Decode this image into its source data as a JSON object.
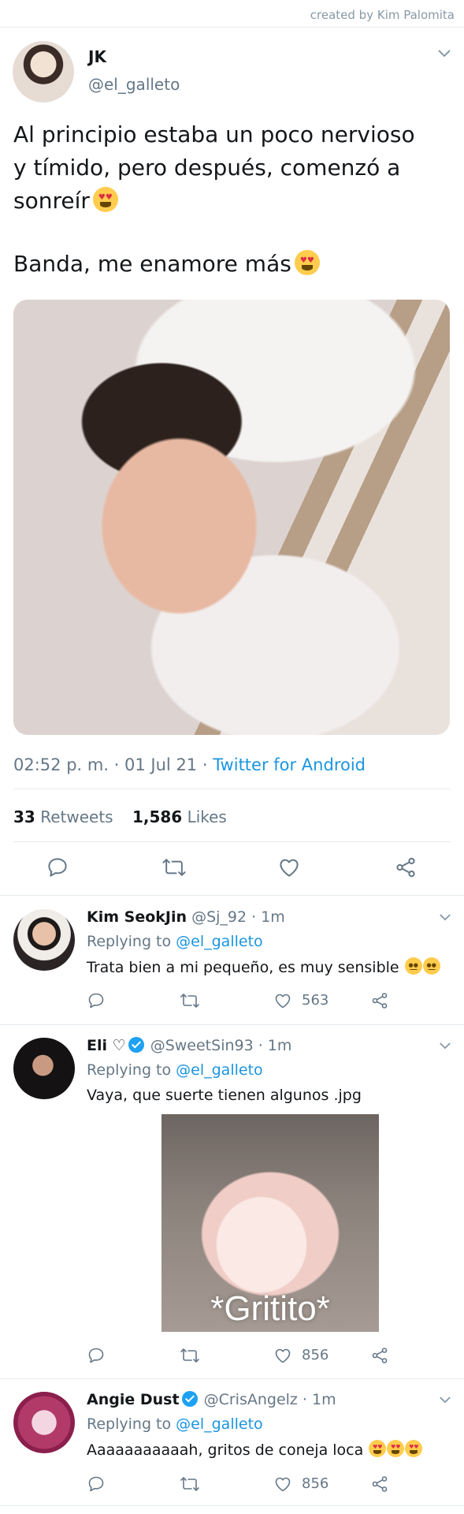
{
  "credit": "created by Kim Palomita",
  "main_tweet": {
    "name": "JK",
    "handle": "@el_galleto",
    "lines": [
      "Al principio estaba un poco nervioso",
      "y tímido, pero después, comenzó a",
      "sonreír"
    ],
    "line2": "Banda, me enamore más",
    "time": "02:52 p. m. · 01 Jul 21 · ",
    "source": "Twitter for Android",
    "retweets_count": "33",
    "retweets_label": "Retweets",
    "likes_count": "1,586",
    "likes_label": "Likes"
  },
  "replies": [
    {
      "name": "Kim SeokJin",
      "handle_time": "@Sj_92 · 1m",
      "replying_label": "Replying to ",
      "replying_to": "@el_galleto",
      "text": "Trata bien a mi pequeño, es muy sensible",
      "likes": "563"
    },
    {
      "name": "Eli ♡",
      "handle_time": "@SweetSin93 · 1m",
      "replying_label": "Replying to ",
      "replying_to": "@el_galleto",
      "text": "Vaya, que suerte tienen algunos .jpg",
      "image_caption": "*Gritito*",
      "likes": "856"
    },
    {
      "name": "Angie Dust",
      "handle_time": "@CrisAngelz · 1m",
      "replying_label": "Replying to ",
      "replying_to": "@el_galleto",
      "text": "Aaaaaaaaaaah, gritos de coneja loca",
      "likes": "856"
    }
  ],
  "colors": {
    "link": "#1b95e0",
    "secondary_text": "#657786",
    "divider": "#e6ecf0",
    "verified": "#1da1f2"
  },
  "icons": [
    "reply-icon",
    "retweet-icon",
    "like-icon",
    "share-icon",
    "chevron-down-icon",
    "verified-icon"
  ]
}
